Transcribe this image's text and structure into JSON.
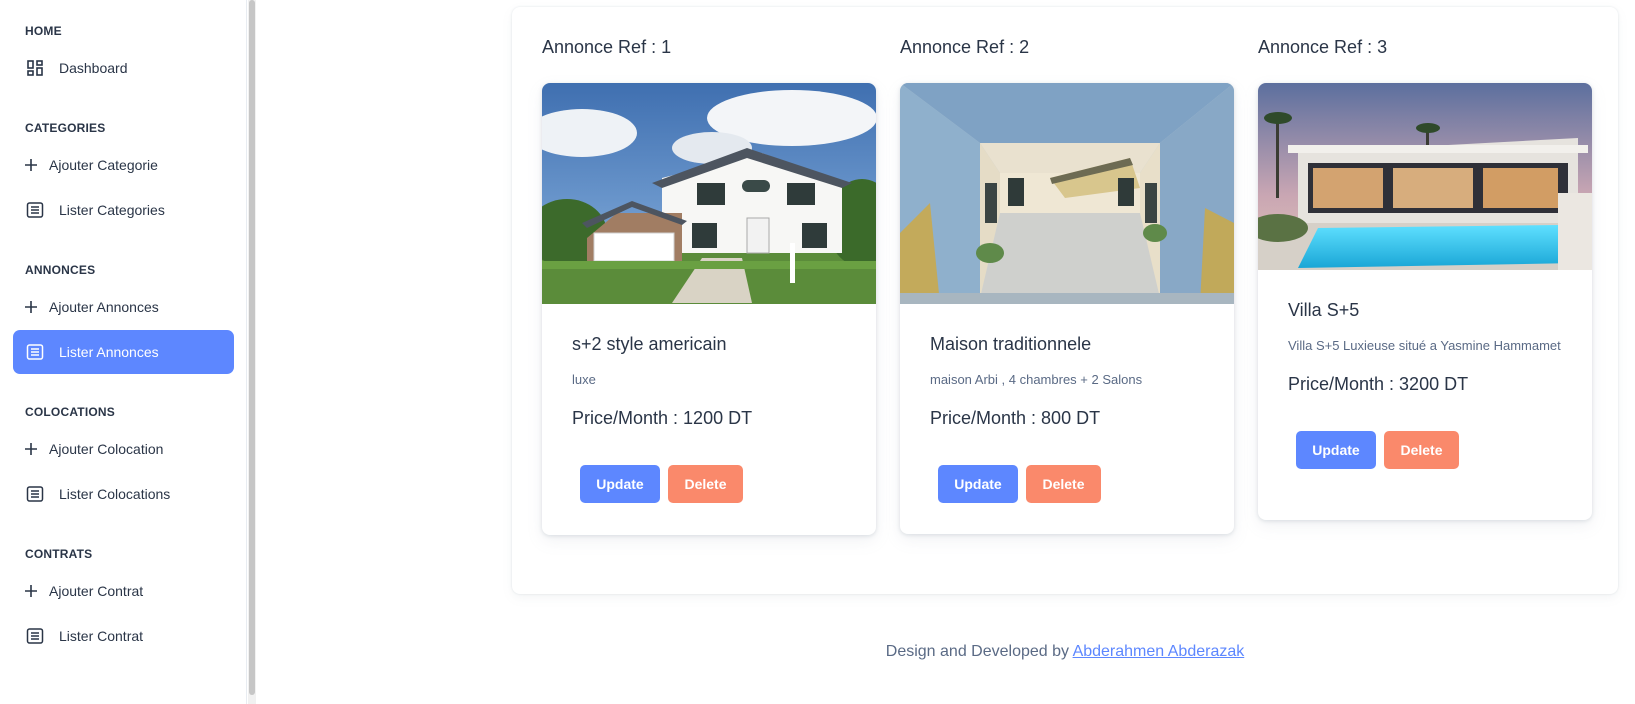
{
  "sidebar": {
    "sections": [
      {
        "title": "HOME"
      },
      {
        "title": "CATEGORIES"
      },
      {
        "title": "ANNONCES"
      },
      {
        "title": "COLOCATIONS"
      },
      {
        "title": "CONTRATS"
      }
    ],
    "items": [
      {
        "label": "Dashboard",
        "icon": "dashboard-icon"
      },
      {
        "label": "Ajouter Categorie",
        "icon": "plus-icon"
      },
      {
        "label": "Lister Categories",
        "icon": "list-icon"
      },
      {
        "label": "Ajouter Annonces",
        "icon": "plus-icon"
      },
      {
        "label": "Lister Annonces",
        "icon": "list-icon",
        "active": true
      },
      {
        "label": "Ajouter Colocation",
        "icon": "plus-icon"
      },
      {
        "label": "Lister Colocations",
        "icon": "list-icon"
      },
      {
        "label": "Ajouter Contrat",
        "icon": "plus-icon"
      },
      {
        "label": "Lister Contrat",
        "icon": "list-icon"
      }
    ]
  },
  "annonces": [
    {
      "ref_label": "Annonce Ref : 1",
      "name": "s+2 style americain",
      "description": "luxe",
      "price": "Price/Month : 1200 DT",
      "image": "american-house-photo",
      "update_label": "Update",
      "delete_label": "Delete"
    },
    {
      "ref_label": "Annonce Ref : 2",
      "name": "Maison traditionnele",
      "description": "maison Arbi , 4 chambres + 2 Salons",
      "price": "Price/Month : 800 DT",
      "image": "traditional-courtyard-photo",
      "update_label": "Update",
      "delete_label": "Delete"
    },
    {
      "ref_label": "Annonce Ref : 3",
      "name": "Villa S+5",
      "description": "Villa S+5 Luxieuse situé a Yasmine Hammamet",
      "price": "Price/Month : 3200 DT",
      "image": "modern-villa-pool-photo",
      "update_label": "Update",
      "delete_label": "Delete"
    }
  ],
  "footer": {
    "text": "Design and Developed by ",
    "author_link": "Abderahmen Abderazak"
  },
  "colors": {
    "primary": "#5d87ff",
    "danger": "#fa896b",
    "text": "#2a3547",
    "muted": "#5a6a85"
  }
}
